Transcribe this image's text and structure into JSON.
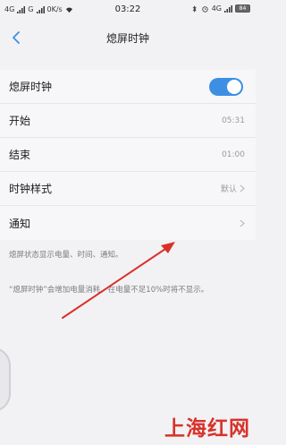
{
  "status_bar": {
    "left_text": "4G",
    "left_text2": "G",
    "speed": "0K/s",
    "time": "03:22",
    "right_network": "4G",
    "battery": "84"
  },
  "nav": {
    "title": "熄屏时钟"
  },
  "settings": {
    "toggle_label": "熄屏时钟",
    "toggle_on": true,
    "start_label": "开始",
    "start_value": "05:31",
    "end_label": "结束",
    "end_value": "01:00",
    "style_label": "时钟样式",
    "style_value": "默认",
    "notify_label": "通知"
  },
  "descriptions": {
    "line1": "熄屏状态显示电量、时间、通知。",
    "line2": "“熄屏时钟”会增加电量消耗，在电量不足10%时将不显示。"
  },
  "watermark": "上海红网",
  "colors": {
    "toggle_accent": "#3d8fe4",
    "arrow": "#d8322a",
    "watermark": "#d8322a"
  }
}
